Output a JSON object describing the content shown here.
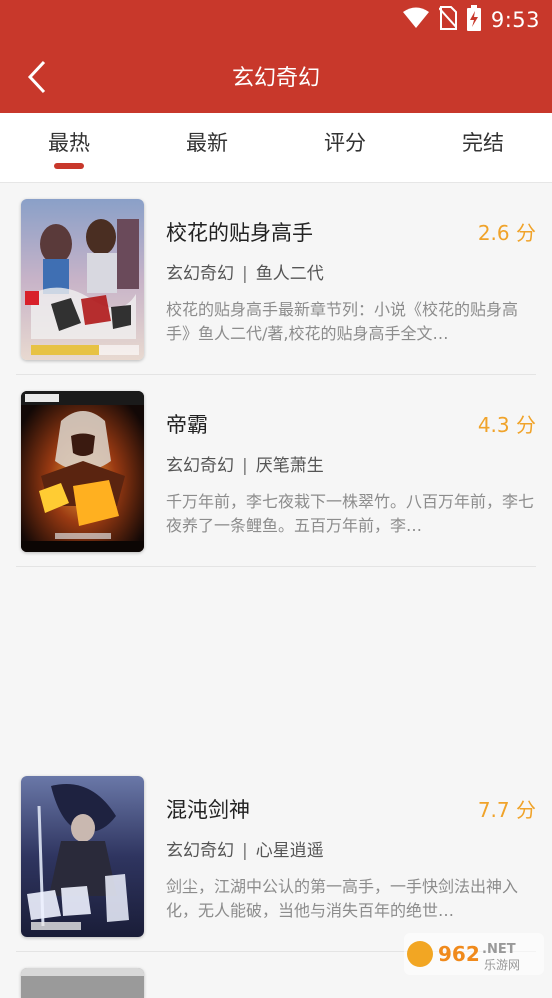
{
  "status_bar": {
    "time": "9:53"
  },
  "header": {
    "title": "玄幻奇幻"
  },
  "tabs": [
    {
      "label": "最热",
      "active": true
    },
    {
      "label": "最新",
      "active": false
    },
    {
      "label": "评分",
      "active": false
    },
    {
      "label": "完结",
      "active": false
    }
  ],
  "books": [
    {
      "title": "校花的贴身高手",
      "rating": "2.6 分",
      "category": "玄幻奇幻",
      "author": "鱼人二代",
      "description": "校花的贴身高手最新章节列：小说《校花的贴身高手》鱼人二代/著,校花的贴身高手全文…"
    },
    {
      "title": "帝霸",
      "rating": "4.3 分",
      "category": "玄幻奇幻",
      "author": "厌笔萧生",
      "description": "千万年前，李七夜栽下一株翠竹。八百万年前，李七夜养了一条鲤鱼。五百万年前，李…"
    },
    {
      "title": "混沌剑神",
      "rating": "7.7 分",
      "category": "玄幻奇幻",
      "author": "心星逍遥",
      "description": "剑尘，江湖中公认的第一高手，一手快剑法出神入化，无人能破，当他与消失百年的绝世…"
    }
  ],
  "watermark": {
    "brand": "962.NET",
    "sub": "乐游网"
  },
  "colors": {
    "primary": "#c8382b",
    "rating": "#f0a32a",
    "background": "#f6f6f6"
  }
}
